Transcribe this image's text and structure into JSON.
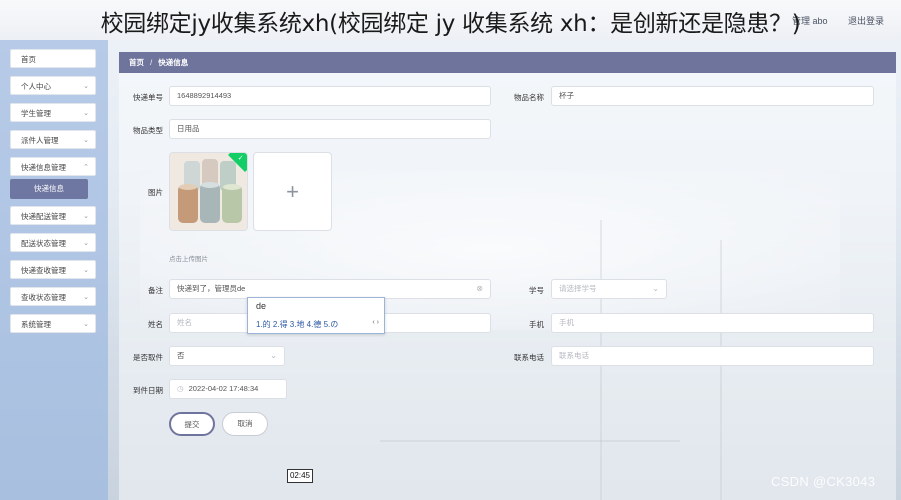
{
  "overlay": {
    "title": "校园绑定jy收集系统xh(校园绑定 jy 收集系统 xh：是创新还是隐患？)"
  },
  "topbar": {
    "user": "管理 abo",
    "logout": "退出登录"
  },
  "sidebar": {
    "items": [
      {
        "label": "首页"
      },
      {
        "label": "个人中心"
      },
      {
        "label": "学生管理"
      },
      {
        "label": "派件人管理"
      },
      {
        "label": "快递信息管理"
      },
      {
        "label": "快递配送管理"
      },
      {
        "label": "配送状态管理"
      },
      {
        "label": "快递查收管理"
      },
      {
        "label": "查收状态管理"
      },
      {
        "label": "系统管理"
      }
    ],
    "active_sub": "快递信息"
  },
  "breadcrumb": {
    "home": "首页",
    "sep": "/",
    "current": "快递信息"
  },
  "form": {
    "tracking_no": {
      "label": "快递单号",
      "value": "1648892914493"
    },
    "item_name": {
      "label": "物品名称",
      "value": "杯子"
    },
    "item_type": {
      "label": "物品类型",
      "value": "日用品"
    },
    "image": {
      "label": "图片",
      "hint": "点击上传图片",
      "add_symbol": "+"
    },
    "remark": {
      "label": "备注",
      "value": "快递到了，管理员de"
    },
    "student_no": {
      "label": "学号",
      "placeholder": "请选择学号"
    },
    "name": {
      "label": "姓名",
      "placeholder": "姓名"
    },
    "phone": {
      "label": "手机",
      "placeholder": "手机"
    },
    "picked_up": {
      "label": "是否取件",
      "value": "否"
    },
    "contact": {
      "label": "联系电话",
      "placeholder": "联系电话"
    },
    "arrival_date": {
      "label": "到件日期",
      "value": "2022-04-02 17:48:34"
    },
    "submit": "提交",
    "cancel": "取消"
  },
  "ime": {
    "composition": "de",
    "candidates": "1.的  2.得  3.地  4.德  5.の",
    "arrows": "‹ ›"
  },
  "video": {
    "time": "02:45"
  },
  "watermark": "CSDN @CK3043"
}
